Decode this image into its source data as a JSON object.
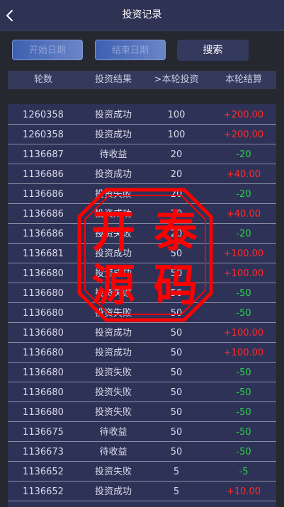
{
  "header": {
    "title": "投资记录",
    "back_icon": "chevron-left-icon"
  },
  "filters": {
    "start_label": "开始日期",
    "end_label": "结束日期",
    "search_label": "搜索",
    "accent": "#4a69bd"
  },
  "columns": [
    "轮数",
    "投资结果",
    ">本轮投资",
    "本轮结算"
  ],
  "colors": {
    "positive": "#ff2b2b",
    "negative": "#2bd04a"
  },
  "rows": [
    {
      "round": "1260358",
      "result": "投资成功",
      "invest": "100",
      "settle": "+200.00",
      "tone": "pos"
    },
    {
      "round": "1260358",
      "result": "投资成功",
      "invest": "100",
      "settle": "+200.00",
      "tone": "pos"
    },
    {
      "round": "1136687",
      "result": "待收益",
      "invest": "20",
      "settle": "-20",
      "tone": "neg"
    },
    {
      "round": "1136686",
      "result": "投资成功",
      "invest": "20",
      "settle": "+40.00",
      "tone": "pos"
    },
    {
      "round": "1136686",
      "result": "投资失败",
      "invest": "20",
      "settle": "-20",
      "tone": "neg"
    },
    {
      "round": "1136686",
      "result": "投资成功",
      "invest": "20",
      "settle": "+40.00",
      "tone": "pos"
    },
    {
      "round": "1136686",
      "result": "投资失败",
      "invest": "20",
      "settle": "-20",
      "tone": "neg"
    },
    {
      "round": "1136681",
      "result": "投资成功",
      "invest": "50",
      "settle": "+100.00",
      "tone": "pos"
    },
    {
      "round": "1136680",
      "result": "投资成功",
      "invest": "50",
      "settle": "+100.00",
      "tone": "pos"
    },
    {
      "round": "1136680",
      "result": "投资失败",
      "invest": "50",
      "settle": "-50",
      "tone": "neg"
    },
    {
      "round": "1136680",
      "result": "投资失败",
      "invest": "50",
      "settle": "-50",
      "tone": "neg"
    },
    {
      "round": "1136680",
      "result": "投资成功",
      "invest": "50",
      "settle": "+100.00",
      "tone": "pos"
    },
    {
      "round": "1136680",
      "result": "投资成功",
      "invest": "50",
      "settle": "+100.00",
      "tone": "pos"
    },
    {
      "round": "1136680",
      "result": "投资失败",
      "invest": "50",
      "settle": "-50",
      "tone": "neg"
    },
    {
      "round": "1136680",
      "result": "投资失败",
      "invest": "50",
      "settle": "-50",
      "tone": "neg"
    },
    {
      "round": "1136680",
      "result": "投资失败",
      "invest": "50",
      "settle": "-50",
      "tone": "neg"
    },
    {
      "round": "1136675",
      "result": "待收益",
      "invest": "50",
      "settle": "-50",
      "tone": "neg"
    },
    {
      "round": "1136673",
      "result": "待收益",
      "invest": "50",
      "settle": "-50",
      "tone": "neg"
    },
    {
      "round": "1136652",
      "result": "投资失败",
      "invest": "5",
      "settle": "-5",
      "tone": "neg"
    },
    {
      "round": "1136652",
      "result": "投资成功",
      "invest": "5",
      "settle": "+10.00",
      "tone": "pos"
    }
  ],
  "watermark": {
    "chars": [
      "开",
      "泰",
      "源",
      "码"
    ],
    "color": "#ff0000"
  }
}
